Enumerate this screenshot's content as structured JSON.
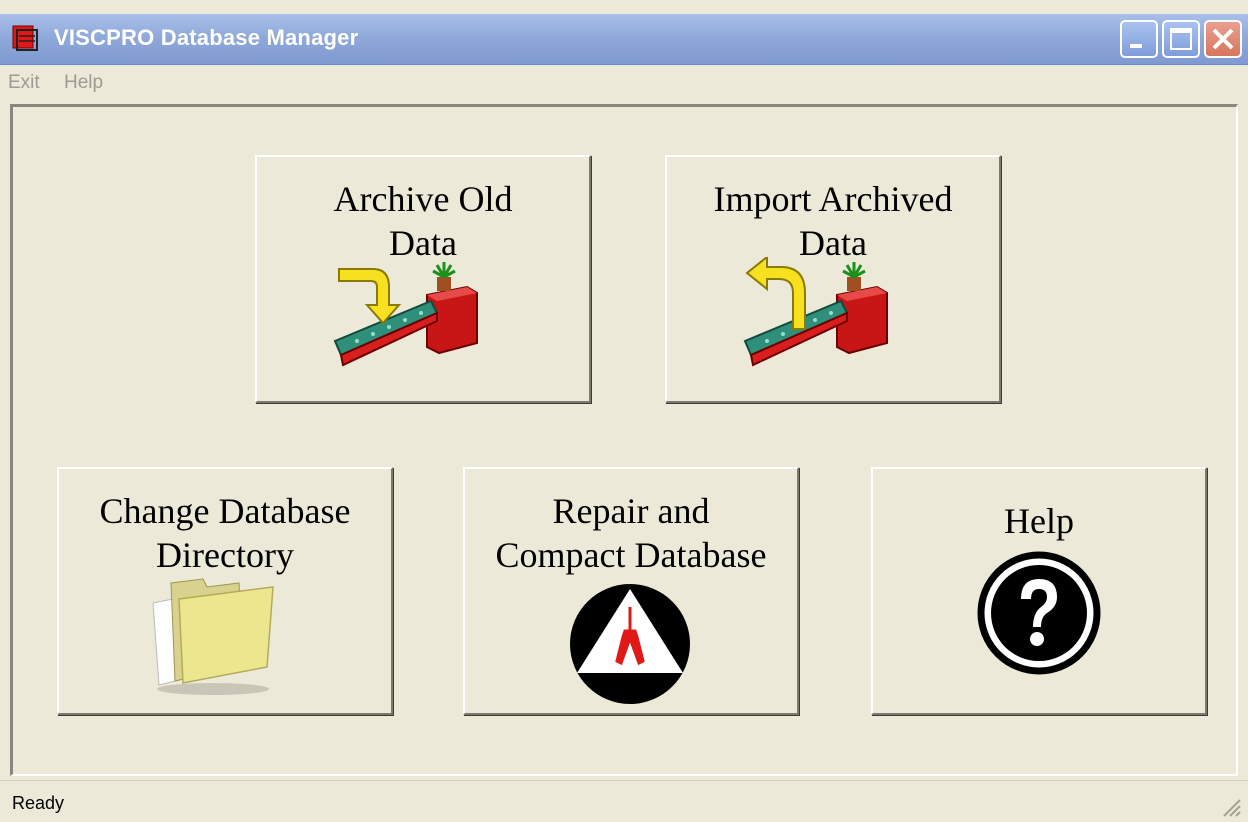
{
  "window": {
    "title": "VISCPRO Database Manager",
    "controls": [
      "minimize-icon",
      "maximize-icon",
      "close-icon"
    ]
  },
  "menu": {
    "exit": "Exit",
    "help": "Help"
  },
  "buttons": {
    "archive": {
      "label": "Archive Old\nData",
      "icon": "archive-conveyor-icon"
    },
    "import": {
      "label": "Import Archived\nData",
      "icon": "import-conveyor-icon"
    },
    "change_dir": {
      "label": "Change Database\nDirectory",
      "icon": "folder-icon"
    },
    "repair": {
      "label": "Repair and\nCompact Database",
      "icon": "repair-pliers-icon"
    },
    "help": {
      "label": "Help",
      "icon": "help-question-icon"
    }
  },
  "status": {
    "text": "Ready"
  },
  "colors": {
    "title_bar": "#8fa9da",
    "face": "#ece9d8",
    "disabled_menu": "#9d9b92"
  }
}
